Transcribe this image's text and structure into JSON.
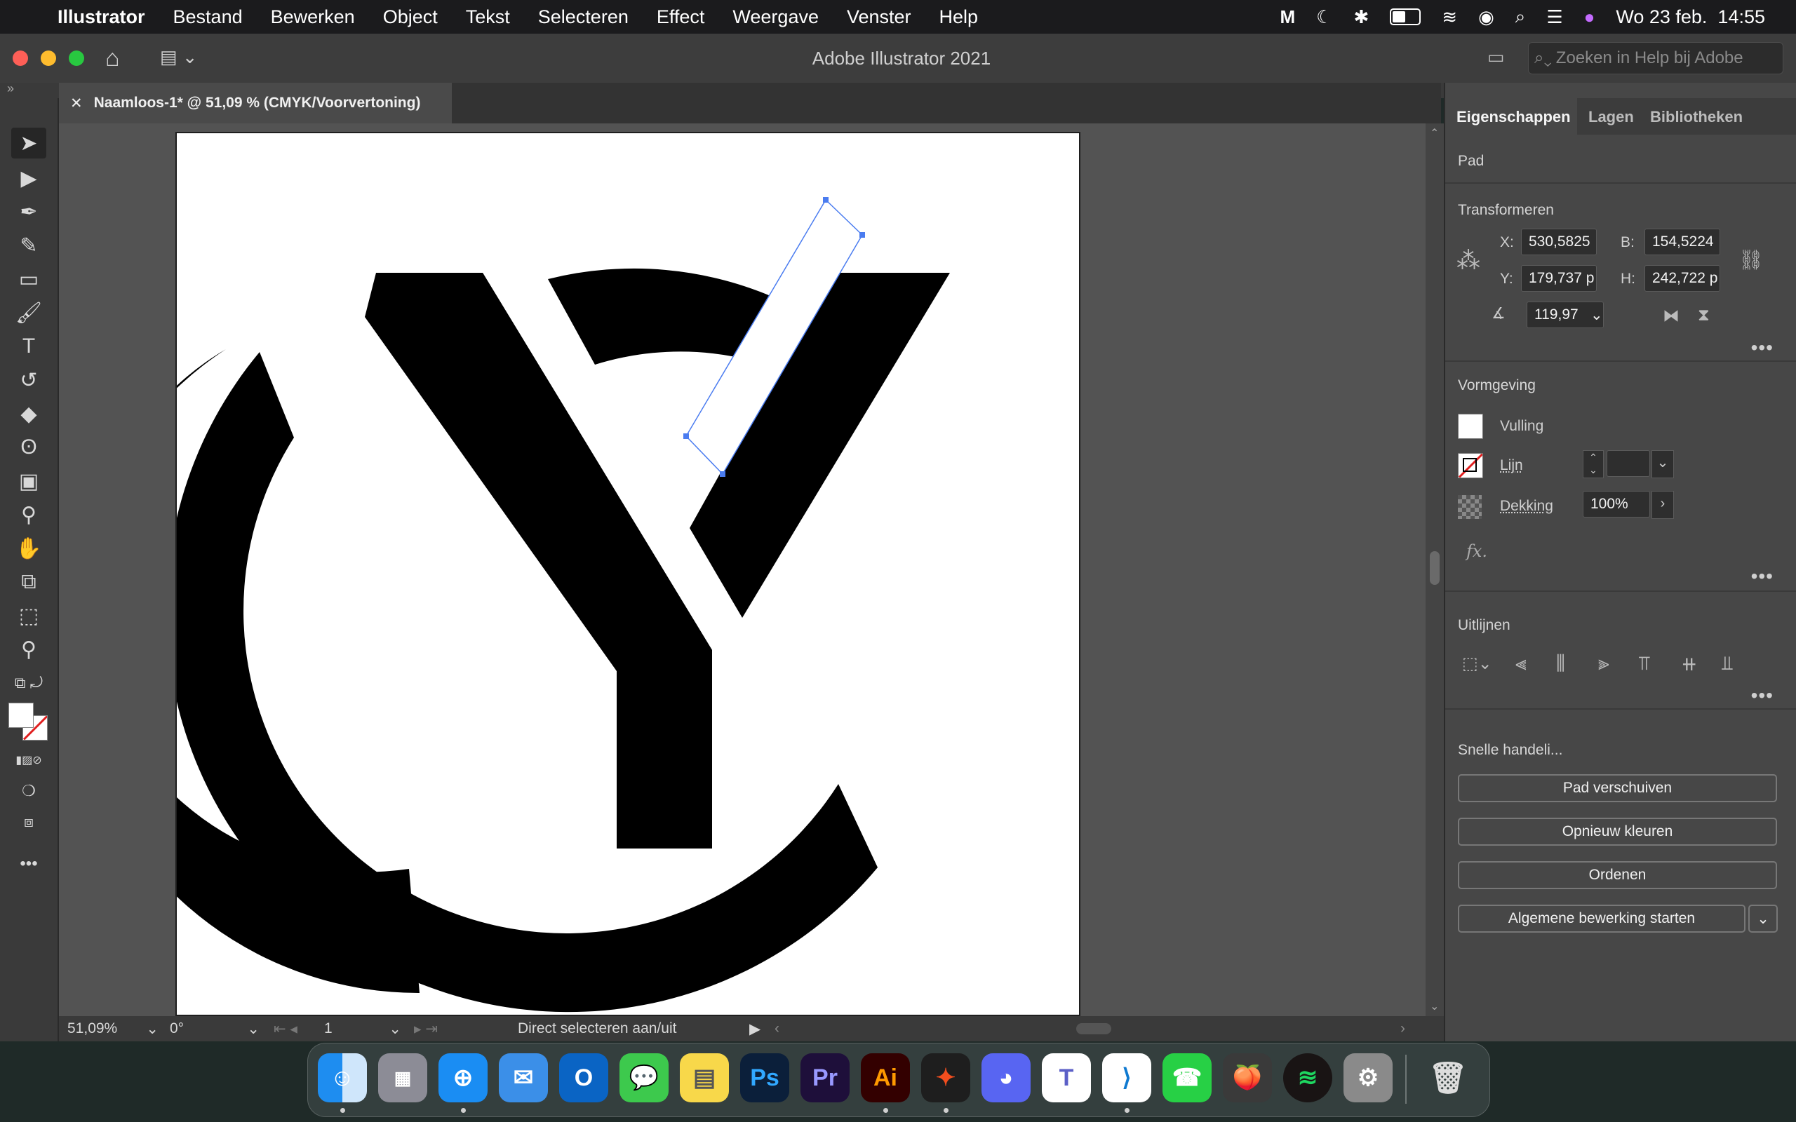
{
  "menubar": {
    "app_name": "Illustrator",
    "items": [
      "Bestand",
      "Bewerken",
      "Object",
      "Tekst",
      "Selecteren",
      "Effect",
      "Weergave",
      "Venster",
      "Help"
    ],
    "clock": "Wo 23 feb.  14:55"
  },
  "window": {
    "title": "Adobe Illustrator 2021",
    "help_search_placeholder": "Zoeken in Help bij Adobe"
  },
  "document": {
    "tab_title": "Naamloos-1* @ 51,09 % (CMYK/Voorvertoning)",
    "close_glyph": "✕"
  },
  "statusbar": {
    "zoom": "51,09%",
    "rotation": "0°",
    "artboard_number": "1",
    "status_text": "Direct selecteren aan/uit"
  },
  "panel": {
    "tabs": [
      "Eigenschappen",
      "Lagen",
      "Bibliotheken"
    ],
    "selection_type": "Pad",
    "transform": {
      "title": "Transformeren",
      "x_label": "X:",
      "x_value": "530,5825",
      "y_label": "Y:",
      "y_value": "179,737 p",
      "w_label": "B:",
      "w_value": "154,5224",
      "h_label": "H:",
      "h_value": "242,722 p",
      "angle_value": "119,97"
    },
    "appearance": {
      "title": "Vormgeving",
      "fill_label": "Vulling",
      "stroke_label": "Lijn",
      "opacity_label": "Dekking",
      "opacity_value": "100%",
      "fx_label": "fx."
    },
    "align": {
      "title": "Uitlijnen"
    },
    "quick_actions": {
      "title": "Snelle handeli...",
      "buttons": [
        "Pad verschuiven",
        "Opnieuw kleuren",
        "Ordenen",
        "Algemene bewerking starten"
      ]
    }
  },
  "dock": {
    "apps": [
      "Finder",
      "Launchpad",
      "Safari",
      "Mail",
      "Outlook",
      "Berichten",
      "Notities",
      "Ps",
      "Pr",
      "Ai",
      "Figma",
      "Discord",
      "Teams",
      "VS Code",
      "WhatsApp",
      "FL Studio",
      "Spotify",
      "Systeemvoorkeuren",
      "Prullenmand"
    ]
  },
  "colors": {
    "selection_blue": "#4a7cf0",
    "panel_bg": "#474747",
    "canvas_bg": "#535353"
  }
}
